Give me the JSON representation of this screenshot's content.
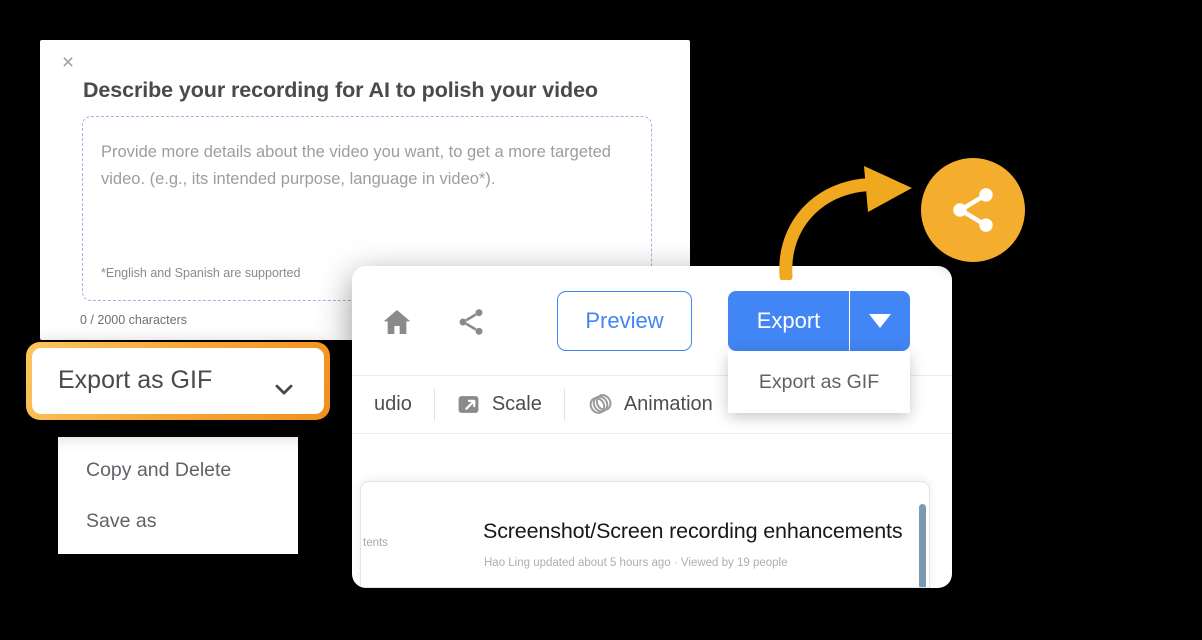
{
  "describe_dialog": {
    "close_label": "×",
    "title": "Describe your recording for AI to polish your video",
    "placeholder": "Provide more details about the video you want, to get a more targeted video. (e.g., its intended purpose, language in video*).",
    "note": "*English and Spanish are supported",
    "counter": "0 / 2000 characters",
    "textarea_value": ""
  },
  "share_badge": {
    "icon": "share-icon",
    "color": "#f5ad2e"
  },
  "arrow": {
    "icon": "curved-arrow-icon",
    "color": "#f5ad2e"
  },
  "editor_card": {
    "toolbar": {
      "home_icon": "home-icon",
      "share_icon": "share-icon",
      "preview_label": "Preview",
      "export_label": "Export",
      "caret_icon": "caret-down-icon",
      "accent_color": "#4285f4"
    },
    "export_menu": {
      "items": [
        "Export as GIF"
      ]
    },
    "tabs": [
      {
        "label": "udio",
        "icon": ""
      },
      {
        "label": "Scale",
        "icon": "scale-icon"
      },
      {
        "label": "Animation",
        "icon": "animation-layers-icon"
      }
    ],
    "document_panel": {
      "side_text": "tents",
      "title": "Screenshot/Screen recording enhancements",
      "meta": "Hao Ling updated about 5 hours ago  ·  Viewed by 19 people",
      "scrollbar_color": "#7d99b0"
    }
  },
  "gif_dropdown": {
    "button_label": "Export as GIF",
    "caret_icon": "chevron-down-icon",
    "highlight_color": "#f7a93a",
    "menu_items": [
      "Copy and Delete",
      "Save as"
    ]
  }
}
